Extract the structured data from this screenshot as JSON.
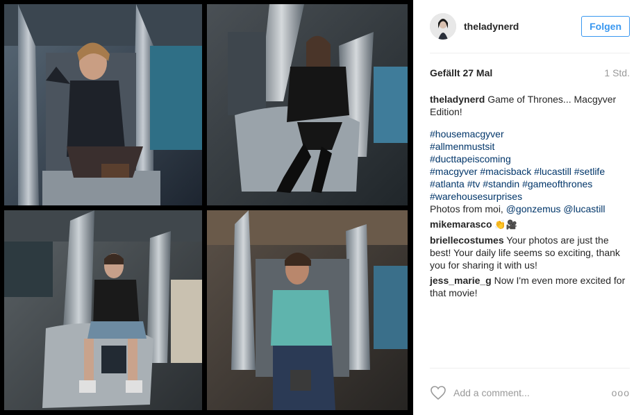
{
  "post": {
    "username": "theladynerd",
    "follow_label": "Folgen",
    "likes": "Gefällt 27 Mal",
    "time": "1 Std.",
    "caption": {
      "author": "theladynerd",
      "text": "Game of Thrones... Macgyver Edition!",
      "hashtag_lines": [
        "#housemacgyver",
        "#allmenmustsit",
        "#ducttapeiscoming",
        "#macgyver #macisback #lucastill #setlife",
        "#atlanta #tv #standin #gameofthrones",
        "#warehousesurprises"
      ],
      "credit_prefix": "Photos from moi,",
      "credit_mentions": "@gonzemus @lucastill"
    },
    "comments": [
      {
        "author": "mikemarasco",
        "text": "👏🎥"
      },
      {
        "author": "briellecostumes",
        "text": "Your photos are just the best! Your daily life seems so exciting, thank you for sharing it with us!"
      },
      {
        "author": "jess_marie_g",
        "text": "Now I'm even more excited for that movie!"
      }
    ],
    "add_comment_placeholder": "Add a comment...",
    "more_label": "ooo"
  },
  "icons": {
    "like": "heart-icon",
    "options": "more-options-icon"
  },
  "colors": {
    "accent": "#3897f0",
    "hashtag": "#003569",
    "muted": "#999999"
  }
}
